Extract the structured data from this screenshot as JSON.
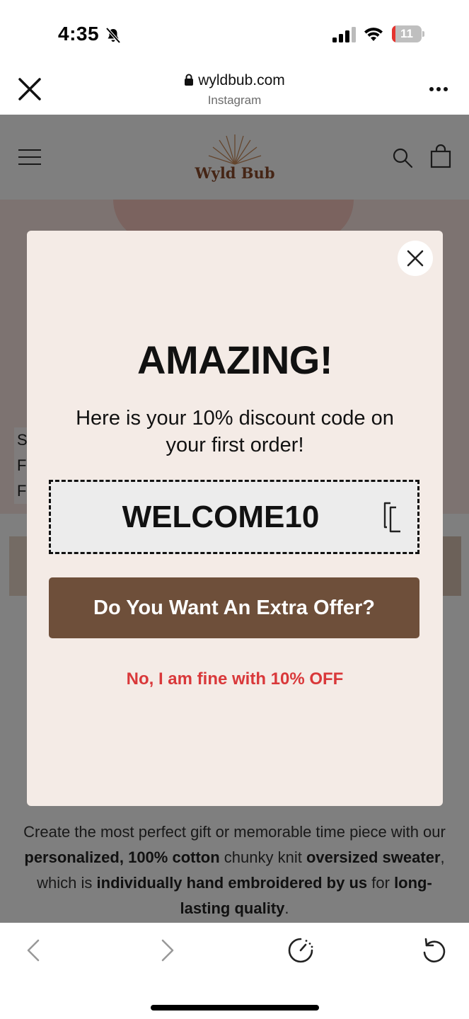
{
  "status_bar": {
    "time": "4:35",
    "battery": "11",
    "battery_level": 0.11,
    "icons": [
      "bell-slash-icon",
      "cellular-signal-icon",
      "wifi-icon",
      "battery-icon"
    ]
  },
  "browser": {
    "url": "wyldbub.com",
    "source": "Instagram",
    "icons": [
      "close-icon",
      "lock-icon",
      "more-icon"
    ]
  },
  "site": {
    "logo_text": "Wyld Bub",
    "hero_caption_lines": [
      "Sv",
      "Fe",
      "Fa"
    ],
    "description_html_parts": {
      "p1": "Create the most perfect gift or memorable time piece with our ",
      "b1": "personalized, 100% cotton",
      "p2": " chunky knit ",
      "b2": "oversized sweater",
      "p3": ", which is ",
      "b3": "individually hand embroidered by us",
      "p4": " for ",
      "b4": "long-lasting quality",
      "p5": "."
    },
    "icons": [
      "hamburger-icon",
      "search-icon",
      "shopping-bag-icon"
    ]
  },
  "modal": {
    "title": "AMAZING!",
    "subtitle": "Here is your 10% discount code on your first order!",
    "code": "WELCOME10",
    "extra_offer_label": "Do You Want An Extra Offer?",
    "decline_label": "No, I am fine with 10% OFF",
    "colors": {
      "background": "#f4ebe6",
      "button": "#6e4f3a",
      "decline": "#d9383a"
    }
  },
  "bottom_bar": {
    "icons": [
      "back-icon",
      "forward-icon",
      "speed-icon",
      "reload-icon"
    ]
  }
}
